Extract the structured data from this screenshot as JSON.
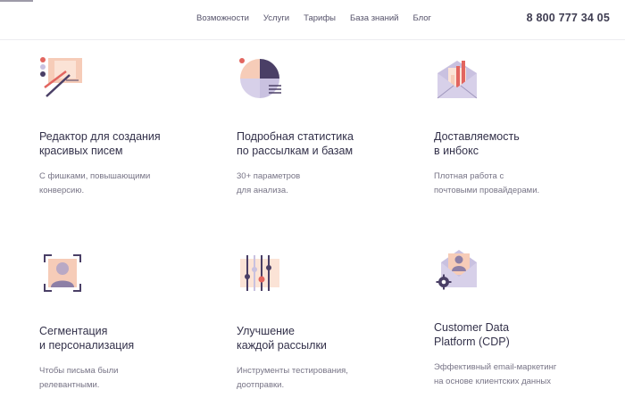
{
  "header": {
    "nav": [
      {
        "label": "Возможности"
      },
      {
        "label": "Услуги"
      },
      {
        "label": "Тарифы"
      },
      {
        "label": "База знаний"
      },
      {
        "label": "Блог"
      }
    ],
    "phone": "8 800 777 34 05"
  },
  "features": [
    {
      "icon": "editor-palette-icon",
      "title": [
        "Редактор для создания",
        "красивых писем"
      ],
      "desc": [
        "С фишками, повышающими",
        "конверсию."
      ]
    },
    {
      "icon": "pie-chart-icon",
      "title": [
        "Подробная статистика",
        "по рассылкам и базам"
      ],
      "desc": [
        "30+ параметров",
        "для анализа."
      ]
    },
    {
      "icon": "envelope-chart-icon",
      "title": [
        "Доставляемость",
        "в инбокс"
      ],
      "desc": [
        "Плотная работа с",
        "почтовыми провайдерами."
      ]
    },
    {
      "icon": "user-focus-icon",
      "title": [
        "Сегментация",
        "и персонализация"
      ],
      "desc": [
        "Чтобы письма были",
        "релевантными."
      ]
    },
    {
      "icon": "sliders-icon",
      "title": [
        "Улучшение",
        "каждой рассылки"
      ],
      "desc": [
        "Инструменты тестирования,",
        "доотправки."
      ]
    },
    {
      "icon": "envelope-user-gear-icon",
      "title": [
        "Customer Data",
        "Platform (CDP)"
      ],
      "desc": [
        "Эффективный email-маркетинг",
        "на основе клиентских данных"
      ]
    }
  ],
  "colors": {
    "accent_purple": "#4a3f66",
    "accent_lavender": "#c9c1e0",
    "accent_peach": "#f6ccb8",
    "accent_red": "#e2655f"
  }
}
